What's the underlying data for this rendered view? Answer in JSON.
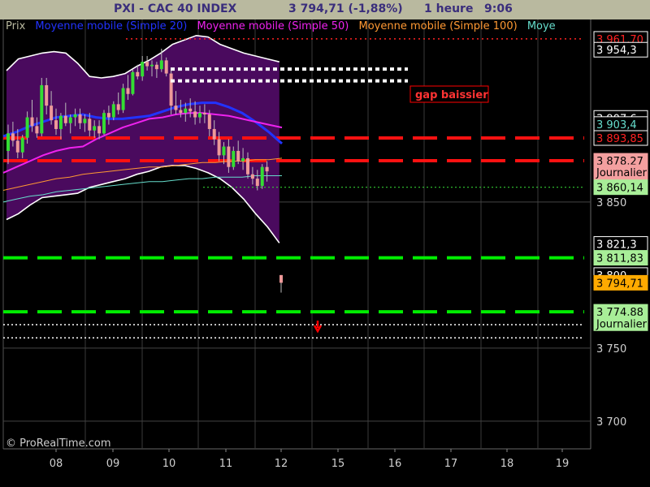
{
  "header": {
    "title": "PXI - CAC 40 INDEX",
    "price": "3 794,71 (-1,88%)",
    "period": "1 heure",
    "time": "9:06"
  },
  "legend": [
    {
      "label": "Prix",
      "color": "#b9b99f"
    },
    {
      "label": "Moyenne mobile (Simple 20)",
      "color": "#2233ff"
    },
    {
      "label": "Moyenne mobile (Simple 50)",
      "color": "#ee22ee"
    },
    {
      "label": "Moyenne mobile (Simple 100)",
      "color": "#ff9933"
    },
    {
      "label": "Moye",
      "color": "#66ddcc"
    }
  ],
  "watermark": "© ProRealTime.com",
  "annotation": "gap baissier",
  "colors": {
    "header_bg": "#b9b99f",
    "bollinger_fill": "#4a0a5e",
    "bull": "#33dd33",
    "bear": "#ee9999",
    "resistance": "#ff0000",
    "support": "#00ee00"
  },
  "chart_data": {
    "type": "line",
    "title": "PXI - CAC 40 INDEX",
    "ylim": [
      3681,
      3975
    ],
    "x_ticks": [
      "08",
      "09",
      "10",
      "11",
      "12",
      "15",
      "16",
      "17",
      "18",
      "19"
    ],
    "y_ticks": [
      "3 850",
      "3 750",
      "3 700"
    ],
    "price_labels": [
      {
        "text": "3 961,70",
        "value": 3961.7,
        "style": "red"
      },
      {
        "text": "3 954,3",
        "value": 3954.3,
        "style": "plain"
      },
      {
        "text": "3 907,6",
        "value": 3907.6,
        "style": "plain"
      },
      {
        "text": "3 903,4",
        "value": 3903.4,
        "style": "cyan"
      },
      {
        "text": "3 893,85",
        "value": 3893.85,
        "style": "red"
      },
      {
        "text": "3 878,27",
        "value": 3878.27,
        "style": "pink"
      },
      {
        "text": "Journalier",
        "value": 3870.5,
        "style": "pink"
      },
      {
        "text": "3 860,14",
        "value": 3860.14,
        "style": "green"
      },
      {
        "text": "3 821,3",
        "value": 3821.3,
        "style": "plain"
      },
      {
        "text": "3 811,83",
        "value": 3811.83,
        "style": "green"
      },
      {
        "text": "3 800",
        "value": 3800,
        "style": "plain"
      },
      {
        "text": "3 794,71",
        "value": 3794.71,
        "style": "orange"
      },
      {
        "text": "3 774,88",
        "value": 3774.88,
        "style": "green"
      },
      {
        "text": "Journalier",
        "value": 3767,
        "style": "green"
      }
    ],
    "horizontal_levels": [
      {
        "value": 3961.7,
        "style": "red-dotted"
      },
      {
        "value": 3893.85,
        "style": "red-dashed"
      },
      {
        "value": 3878.27,
        "style": "red-dashed"
      },
      {
        "value": 3860.14,
        "style": "green-dotted"
      },
      {
        "value": 3811.83,
        "style": "green-dashed"
      },
      {
        "value": 3774.88,
        "style": "green-dashed"
      },
      {
        "value": 3766,
        "style": "white-dotted"
      },
      {
        "value": 3757,
        "style": "white-dotted"
      }
    ],
    "gap_levels": [
      3941,
      3933
    ],
    "candles": [
      {
        "o": 3885,
        "h": 3903,
        "l": 3876,
        "c": 3897
      },
      {
        "o": 3897,
        "h": 3905,
        "l": 3888,
        "c": 3892
      },
      {
        "o": 3892,
        "h": 3900,
        "l": 3880,
        "c": 3884
      },
      {
        "o": 3884,
        "h": 3896,
        "l": 3880,
        "c": 3894
      },
      {
        "o": 3894,
        "h": 3912,
        "l": 3890,
        "c": 3908
      },
      {
        "o": 3908,
        "h": 3920,
        "l": 3898,
        "c": 3902
      },
      {
        "o": 3902,
        "h": 3908,
        "l": 3894,
        "c": 3897
      },
      {
        "o": 3897,
        "h": 3935,
        "l": 3895,
        "c": 3930
      },
      {
        "o": 3930,
        "h": 3935,
        "l": 3910,
        "c": 3916
      },
      {
        "o": 3916,
        "h": 3926,
        "l": 3903,
        "c": 3906
      },
      {
        "o": 3906,
        "h": 3914,
        "l": 3896,
        "c": 3900
      },
      {
        "o": 3900,
        "h": 3911,
        "l": 3893,
        "c": 3909
      },
      {
        "o": 3909,
        "h": 3918,
        "l": 3902,
        "c": 3904
      },
      {
        "o": 3904,
        "h": 3910,
        "l": 3897,
        "c": 3908
      },
      {
        "o": 3908,
        "h": 3914,
        "l": 3902,
        "c": 3910
      },
      {
        "o": 3910,
        "h": 3914,
        "l": 3900,
        "c": 3904
      },
      {
        "o": 3904,
        "h": 3910,
        "l": 3898,
        "c": 3907
      },
      {
        "o": 3907,
        "h": 3911,
        "l": 3895,
        "c": 3899
      },
      {
        "o": 3899,
        "h": 3906,
        "l": 3894,
        "c": 3902
      },
      {
        "o": 3902,
        "h": 3906,
        "l": 3893,
        "c": 3897
      },
      {
        "o": 3897,
        "h": 3913,
        "l": 3896,
        "c": 3911
      },
      {
        "o": 3911,
        "h": 3916,
        "l": 3903,
        "c": 3908
      },
      {
        "o": 3908,
        "h": 3919,
        "l": 3906,
        "c": 3917
      },
      {
        "o": 3917,
        "h": 3925,
        "l": 3910,
        "c": 3913
      },
      {
        "o": 3913,
        "h": 3931,
        "l": 3911,
        "c": 3928
      },
      {
        "o": 3928,
        "h": 3937,
        "l": 3920,
        "c": 3924
      },
      {
        "o": 3924,
        "h": 3941,
        "l": 3923,
        "c": 3939
      },
      {
        "o": 3939,
        "h": 3944,
        "l": 3934,
        "c": 3936
      },
      {
        "o": 3936,
        "h": 3950,
        "l": 3933,
        "c": 3946
      },
      {
        "o": 3946,
        "h": 3950,
        "l": 3940,
        "c": 3943
      },
      {
        "o": 3943,
        "h": 3947,
        "l": 3936,
        "c": 3944
      },
      {
        "o": 3944,
        "h": 3946,
        "l": 3935,
        "c": 3941
      },
      {
        "o": 3941,
        "h": 3955,
        "l": 3939,
        "c": 3947
      },
      {
        "o": 3947,
        "h": 3949,
        "l": 3936,
        "c": 3938
      },
      {
        "o": 3938,
        "h": 3942,
        "l": 3910,
        "c": 3916
      },
      {
        "o": 3916,
        "h": 3926,
        "l": 3910,
        "c": 3913
      },
      {
        "o": 3913,
        "h": 3920,
        "l": 3908,
        "c": 3911
      },
      {
        "o": 3911,
        "h": 3918,
        "l": 3905,
        "c": 3914
      },
      {
        "o": 3914,
        "h": 3921,
        "l": 3908,
        "c": 3912
      },
      {
        "o": 3912,
        "h": 3919,
        "l": 3903,
        "c": 3908
      },
      {
        "o": 3908,
        "h": 3916,
        "l": 3904,
        "c": 3911
      },
      {
        "o": 3911,
        "h": 3917,
        "l": 3904,
        "c": 3910
      },
      {
        "o": 3910,
        "h": 3913,
        "l": 3895,
        "c": 3900
      },
      {
        "o": 3900,
        "h": 3906,
        "l": 3889,
        "c": 3893
      },
      {
        "o": 3893,
        "h": 3898,
        "l": 3878,
        "c": 3882
      },
      {
        "o": 3882,
        "h": 3891,
        "l": 3876,
        "c": 3888
      },
      {
        "o": 3888,
        "h": 3893,
        "l": 3870,
        "c": 3874
      },
      {
        "o": 3874,
        "h": 3888,
        "l": 3872,
        "c": 3885
      },
      {
        "o": 3885,
        "h": 3892,
        "l": 3876,
        "c": 3878
      },
      {
        "o": 3878,
        "h": 3887,
        "l": 3872,
        "c": 3880
      },
      {
        "o": 3880,
        "h": 3884,
        "l": 3866,
        "c": 3869
      },
      {
        "o": 3869,
        "h": 3874,
        "l": 3862,
        "c": 3866
      },
      {
        "o": 3866,
        "h": 3872,
        "l": 3858,
        "c": 3861
      },
      {
        "o": 3861,
        "h": 3876,
        "l": 3859,
        "c": 3874
      },
      {
        "o": 3874,
        "h": 3878,
        "l": 3864,
        "c": 3871
      },
      {
        "o": 3800,
        "h": 3800,
        "l": 3788,
        "c": 3794.71
      }
    ],
    "series": [
      {
        "name": "Moyenne mobile (Simple 20)",
        "color": "#2233ff",
        "values": [
          3895,
          3898,
          3902,
          3905,
          3908,
          3909,
          3910,
          3908,
          3907,
          3907,
          3908,
          3909,
          3912,
          3915,
          3917,
          3918,
          3918,
          3915,
          3911,
          3905,
          3898,
          3890
        ]
      },
      {
        "name": "Moyenne mobile (Simple 50)",
        "color": "#ee22ee",
        "values": [
          3870,
          3874,
          3878,
          3882,
          3885,
          3887,
          3888,
          3893,
          3897,
          3901,
          3904,
          3907,
          3908,
          3910,
          3911,
          3911,
          3910,
          3909,
          3907,
          3905,
          3903,
          3901
        ]
      },
      {
        "name": "Moyenne mobile (Simple 100)",
        "color": "#ff9933",
        "values": [
          3858,
          3860,
          3862,
          3864,
          3866,
          3867,
          3869,
          3870,
          3871,
          3872,
          3873,
          3874,
          3874,
          3875,
          3876,
          3877,
          3877,
          3878,
          3878,
          3879,
          3879,
          3880
        ]
      },
      {
        "name": "Moye",
        "color": "#66ddcc",
        "values": [
          3850,
          3852,
          3854,
          3855,
          3857,
          3858,
          3859,
          3860,
          3861,
          3862,
          3863,
          3864,
          3864,
          3865,
          3866,
          3866,
          3867,
          3867,
          3867,
          3868,
          3868,
          3868
        ]
      }
    ],
    "bollinger": {
      "upper": [
        3940,
        3948,
        3950,
        3952,
        3953,
        3952,
        3945,
        3936,
        3935,
        3936,
        3938,
        3943,
        3947,
        3952,
        3958,
        3961,
        3964,
        3963,
        3958,
        3955,
        3952,
        3950,
        3948,
        3946
      ],
      "lower": [
        3838,
        3842,
        3848,
        3853,
        3854,
        3855,
        3856,
        3860,
        3862,
        3864,
        3866,
        3869,
        3871,
        3874,
        3875,
        3875,
        3873,
        3870,
        3866,
        3860,
        3852,
        3842,
        3833,
        3822
      ]
    }
  }
}
